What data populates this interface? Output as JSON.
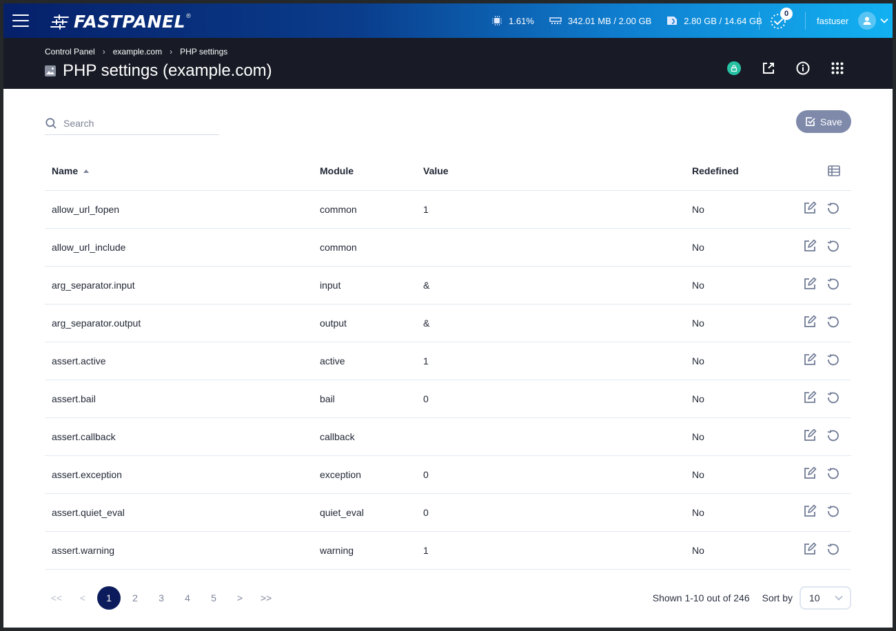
{
  "topbar": {
    "brand": "FASTPANEL",
    "brand_mark": "®",
    "cpu": "1.61%",
    "ram": "342.01 MB / 2.00 GB",
    "disk": "2.80 GB / 14.64 GB",
    "tasks_count": "0",
    "username": "fastuser"
  },
  "header": {
    "breadcrumb": [
      "Control Panel",
      "example.com",
      "PHP settings"
    ],
    "breadcrumb_sep": "›",
    "title": "PHP settings (example.com)",
    "colors": {
      "lock_badge": "#27c2a4"
    }
  },
  "toolbar": {
    "search_placeholder": "Search",
    "search_value": "",
    "save_label": "Save"
  },
  "table": {
    "columns": {
      "name": "Name",
      "module": "Module",
      "value": "Value",
      "redefined": "Redefined"
    },
    "sort": {
      "column": "name",
      "direction": "asc"
    },
    "rows": [
      {
        "name": "allow_url_fopen",
        "module": "common",
        "value": "1",
        "redefined": "No"
      },
      {
        "name": "allow_url_include",
        "module": "common",
        "value": "",
        "redefined": "No"
      },
      {
        "name": "arg_separator.input",
        "module": "input",
        "value": "&",
        "redefined": "No"
      },
      {
        "name": "arg_separator.output",
        "module": "output",
        "value": "&",
        "redefined": "No"
      },
      {
        "name": "assert.active",
        "module": "active",
        "value": "1",
        "redefined": "No"
      },
      {
        "name": "assert.bail",
        "module": "bail",
        "value": "0",
        "redefined": "No"
      },
      {
        "name": "assert.callback",
        "module": "callback",
        "value": "",
        "redefined": "No"
      },
      {
        "name": "assert.exception",
        "module": "exception",
        "value": "0",
        "redefined": "No"
      },
      {
        "name": "assert.quiet_eval",
        "module": "quiet_eval",
        "value": "0",
        "redefined": "No"
      },
      {
        "name": "assert.warning",
        "module": "warning",
        "value": "1",
        "redefined": "No"
      }
    ]
  },
  "pagination": {
    "first": "<<",
    "prev": "<",
    "pages": [
      "1",
      "2",
      "3",
      "4",
      "5"
    ],
    "current": "1",
    "next": ">",
    "last": ">>",
    "shown_text": "Shown 1-10 out of 246",
    "sort_by_label": "Sort by",
    "per_page": "10"
  },
  "colors": {
    "accent_dark": "#0b1b5c",
    "save_button": "#7f8aab",
    "header_bg": "#181b26"
  }
}
